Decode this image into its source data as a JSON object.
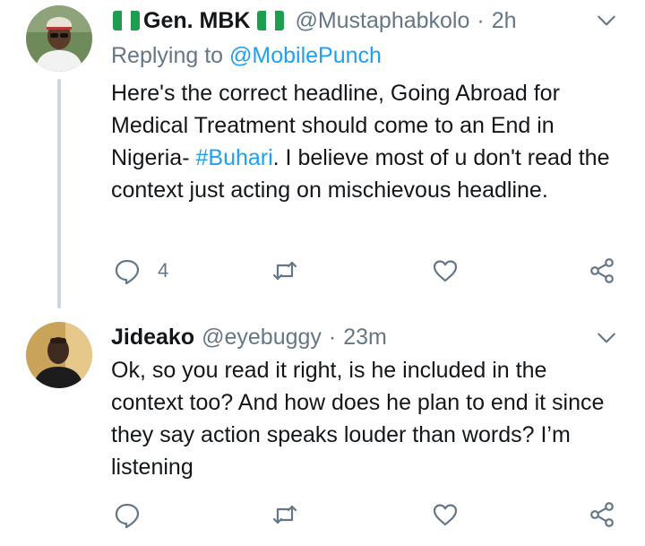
{
  "colors": {
    "text": "#14171a",
    "secondary": "#657786",
    "link": "#1da1f2",
    "thread_line": "#ccd6dd",
    "flag_green": "#1f9d4f"
  },
  "tweets": [
    {
      "display_name": "Gen. MBK",
      "name_decoration": "nigeria-flag-emoji",
      "handle": "@Mustaphabkolo",
      "separator": "·",
      "time": "2h",
      "replying_label": "Replying to",
      "replying_mention": "@MobilePunch",
      "text_before_hashtag": "Here's the correct headline, Going Abroad for Medical Treatment should come to an End in Nigeria- ",
      "hashtag": "#Buhari",
      "text_after_hashtag": ". I believe most of u don't read the context just acting on mischievous headline.",
      "reply_count": "4",
      "icons": [
        "reply-icon",
        "retweet-icon",
        "like-icon",
        "share-icon",
        "chevron-down-icon"
      ]
    },
    {
      "display_name": "Jideako",
      "handle": "@eyebuggy",
      "separator": "·",
      "time": "23m",
      "text": "Ok, so you read it right, is he included in the context too? And how does he plan to end it since they say action speaks louder than words? I’m listening",
      "icons": [
        "reply-icon",
        "retweet-icon",
        "like-icon",
        "share-icon",
        "chevron-down-icon"
      ]
    }
  ]
}
